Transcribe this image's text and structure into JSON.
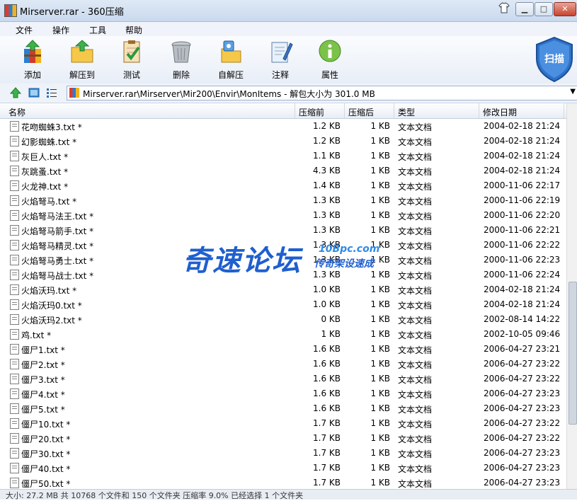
{
  "window": {
    "title": "Mirserver.rar - 360压缩",
    "controls": [
      "shirt-icon",
      "minimize-icon",
      "maximize-icon",
      "close-icon"
    ]
  },
  "menu": [
    "文件",
    "操作",
    "工具",
    "帮助"
  ],
  "toolbar": {
    "items": [
      {
        "label": "添加",
        "icon": "add-archive-icon"
      },
      {
        "label": "解压到",
        "icon": "extract-folder-icon"
      },
      {
        "label": "测试",
        "icon": "test-clipboard-icon"
      },
      {
        "label": "删除",
        "icon": "trash-bin-icon"
      },
      {
        "label": "自解压",
        "icon": "self-extract-icon"
      },
      {
        "label": "注释",
        "icon": "comment-pen-icon"
      },
      {
        "label": "属性",
        "icon": "info-icon"
      }
    ],
    "scan_label": "扫描"
  },
  "address": {
    "path": "Mirserver.rar\\Mirserver\\Mir200\\Envir\\MonItems - 解包大小为 301.0 MB"
  },
  "columns": {
    "name": "名称",
    "size": "压缩前",
    "packed": "压缩后",
    "type": "类型",
    "modified": "修改日期"
  },
  "files": [
    {
      "name": "花吻蜘蛛3.txt *",
      "size": "1.2 KB",
      "packed": "1 KB",
      "type": "文本文档",
      "date": "2004-02-18 21:24"
    },
    {
      "name": "幻影蜘蛛.txt *",
      "size": "1.2 KB",
      "packed": "1 KB",
      "type": "文本文档",
      "date": "2004-02-18 21:24"
    },
    {
      "name": "灰巨人.txt *",
      "size": "1.1 KB",
      "packed": "1 KB",
      "type": "文本文档",
      "date": "2004-02-18 21:24"
    },
    {
      "name": "灰跳蚤.txt *",
      "size": "4.3 KB",
      "packed": "1 KB",
      "type": "文本文档",
      "date": "2004-02-18 21:24"
    },
    {
      "name": "火龙神.txt *",
      "size": "1.4 KB",
      "packed": "1 KB",
      "type": "文本文档",
      "date": "2000-11-06 22:17"
    },
    {
      "name": "火焰弩马.txt *",
      "size": "1.3 KB",
      "packed": "1 KB",
      "type": "文本文档",
      "date": "2000-11-06 22:19"
    },
    {
      "name": "火焰弩马法王.txt *",
      "size": "1.3 KB",
      "packed": "1 KB",
      "type": "文本文档",
      "date": "2000-11-06 22:20"
    },
    {
      "name": "火焰弩马箭手.txt *",
      "size": "1.3 KB",
      "packed": "1 KB",
      "type": "文本文档",
      "date": "2000-11-06 22:21"
    },
    {
      "name": "火焰弩马精灵.txt *",
      "size": "1.3 KB",
      "packed": "1 KB",
      "type": "文本文档",
      "date": "2000-11-06 22:22"
    },
    {
      "name": "火焰弩马勇士.txt *",
      "size": "1.3 KB",
      "packed": "1 KB",
      "type": "文本文档",
      "date": "2000-11-06 22:23"
    },
    {
      "name": "火焰弩马战士.txt *",
      "size": "1.3 KB",
      "packed": "1 KB",
      "type": "文本文档",
      "date": "2000-11-06 22:24"
    },
    {
      "name": "火焰沃玛.txt *",
      "size": "1.0 KB",
      "packed": "1 KB",
      "type": "文本文档",
      "date": "2004-02-18 21:24"
    },
    {
      "name": "火焰沃玛0.txt *",
      "size": "1.0 KB",
      "packed": "1 KB",
      "type": "文本文档",
      "date": "2004-02-18 21:24"
    },
    {
      "name": "火焰沃玛2.txt *",
      "size": "0 KB",
      "packed": "1 KB",
      "type": "文本文档",
      "date": "2002-08-14 14:22"
    },
    {
      "name": "鸡.txt *",
      "size": "1 KB",
      "packed": "1 KB",
      "type": "文本文档",
      "date": "2002-10-05 09:46"
    },
    {
      "name": "僵尸1.txt *",
      "size": "1.6 KB",
      "packed": "1 KB",
      "type": "文本文档",
      "date": "2006-04-27 23:21"
    },
    {
      "name": "僵尸2.txt *",
      "size": "1.6 KB",
      "packed": "1 KB",
      "type": "文本文档",
      "date": "2006-04-27 23:22"
    },
    {
      "name": "僵尸3.txt *",
      "size": "1.6 KB",
      "packed": "1 KB",
      "type": "文本文档",
      "date": "2006-04-27 23:22"
    },
    {
      "name": "僵尸4.txt *",
      "size": "1.6 KB",
      "packed": "1 KB",
      "type": "文本文档",
      "date": "2006-04-27 23:23"
    },
    {
      "name": "僵尸5.txt *",
      "size": "1.6 KB",
      "packed": "1 KB",
      "type": "文本文档",
      "date": "2006-04-27 23:23"
    },
    {
      "name": "僵尸10.txt *",
      "size": "1.7 KB",
      "packed": "1 KB",
      "type": "文本文档",
      "date": "2006-04-27 23:22"
    },
    {
      "name": "僵尸20.txt *",
      "size": "1.7 KB",
      "packed": "1 KB",
      "type": "文本文档",
      "date": "2006-04-27 23:22"
    },
    {
      "name": "僵尸30.txt *",
      "size": "1.7 KB",
      "packed": "1 KB",
      "type": "文本文档",
      "date": "2006-04-27 23:23"
    },
    {
      "name": "僵尸40.txt *",
      "size": "1.7 KB",
      "packed": "1 KB",
      "type": "文本文档",
      "date": "2006-04-27 23:23"
    },
    {
      "name": "僵尸50.txt *",
      "size": "1.7 KB",
      "packed": "1 KB",
      "type": "文本文档",
      "date": "2006-04-27 23:23"
    }
  ],
  "status": "大小: 27.2 MB 共 10768 个文件和 150 个文件夹 压缩率 9.0% 已经选择 1 个文件夹",
  "watermark": {
    "main": "奇速论坛",
    "url": "10Bpc.com",
    "slogan": "传奇架设速成"
  }
}
